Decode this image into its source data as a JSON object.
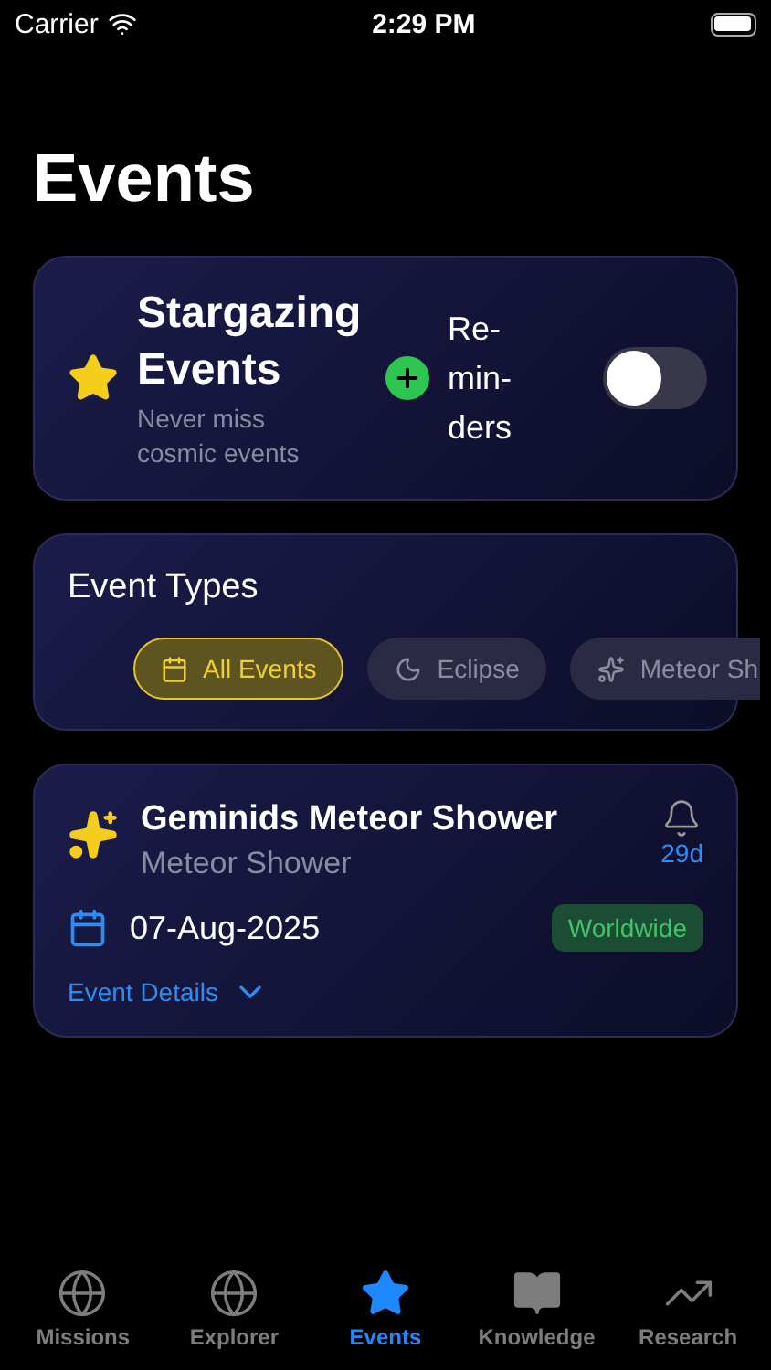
{
  "status_bar": {
    "carrier": "Carrier",
    "time": "2:29 PM"
  },
  "title": "Events",
  "header_card": {
    "title": "Stargazing Events",
    "subtitle": "Never miss cosmic events",
    "reminders_label": "Re-min-ders",
    "reminders_on": false
  },
  "event_types": {
    "title": "Event Types",
    "chips": [
      {
        "label": "All Events",
        "kind": "calendar",
        "selected": true
      },
      {
        "label": "Eclipse",
        "kind": "eclipse",
        "selected": false
      },
      {
        "label": "Meteor Sh",
        "kind": "sparkle",
        "selected": false
      }
    ]
  },
  "events": [
    {
      "title": "Geminids Meteor Shower",
      "type": "Meteor Shower",
      "countdown": "29d",
      "date": "07-Aug-2025",
      "region": "Worldwide",
      "details": "Event Details",
      "expanded": false
    }
  ],
  "tab_bar": [
    {
      "label": "Missions",
      "kind": "globe",
      "selected": false
    },
    {
      "label": "Explorer",
      "kind": "globe",
      "selected": false
    },
    {
      "label": "Events",
      "kind": "star",
      "selected": true
    },
    {
      "label": "Knowledge",
      "kind": "book",
      "selected": false
    },
    {
      "label": "Research",
      "kind": "chart",
      "selected": false
    }
  ]
}
